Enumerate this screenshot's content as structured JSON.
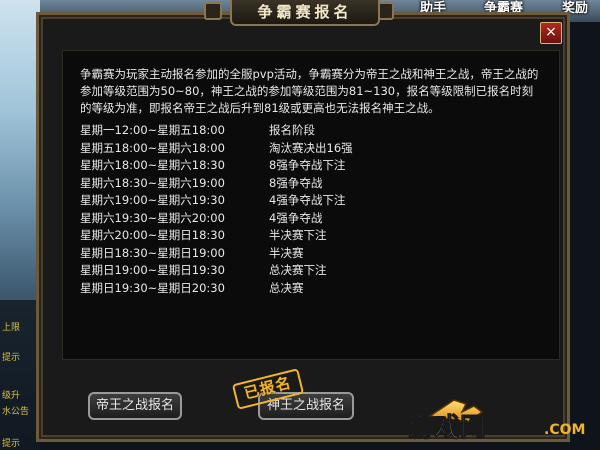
{
  "top_menu": [
    "助手",
    "争霸赛",
    "奖励"
  ],
  "hud_left": [
    "上限",
    "提示",
    "级升",
    "水公告",
    "提示"
  ],
  "dialog": {
    "title": "争霸赛报名",
    "close_label": "×",
    "intro": "争霸赛为玩家主动报名参加的全服pvp活动，争霸赛分为帝王之战和神王之战，帝王之战的参加等级范围为50~80，神王之战的参加等级范围为81~130，报名等级限制已报名时刻的等级为准，即报名帝王之战后升到81级或更高也无法报名神王之战。",
    "schedule": [
      {
        "time": "星期一12:00~星期五18:00",
        "stage": "报名阶段"
      },
      {
        "time": "星期五18:00~星期六18:00",
        "stage": "淘汰赛决出16强"
      },
      {
        "time": "星期六18:00~星期六18:30",
        "stage": "8强争夺战下注"
      },
      {
        "time": "星期六18:30~星期六19:00",
        "stage": "8强争夺战"
      },
      {
        "time": "星期六19:00~星期六19:30",
        "stage": "4强争夺战下注"
      },
      {
        "time": "星期六19:30~星期六20:00",
        "stage": "4强争夺战"
      },
      {
        "time": "星期六20:00~星期日18:30",
        "stage": "半决赛下注"
      },
      {
        "time": "星期日18:30~星期日19:00",
        "stage": "半决赛"
      },
      {
        "time": "星期日19:00~星期日19:30",
        "stage": "总决赛下注"
      },
      {
        "time": "星期日19:30~星期日20:30",
        "stage": "总决赛"
      }
    ],
    "btn_emperor": "帝王之战报名",
    "btn_god": "神王之战报名",
    "registered_stamp": "已报名"
  },
  "logo_text": "游戏网",
  "logo_suffix": ".COM",
  "colors": {
    "accent_gold": "#f0b52a",
    "frame": "#6b5a3c",
    "close_red": "#b02a1e"
  }
}
